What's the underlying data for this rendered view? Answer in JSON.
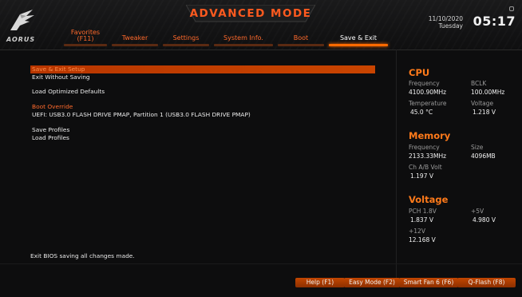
{
  "brand": {
    "logo_text": "AORUS"
  },
  "header": {
    "title": "ADVANCED MODE",
    "date": "11/10/2020",
    "day": "Tuesday",
    "time": "05:17"
  },
  "tabs": [
    {
      "label_line1": "Favorites",
      "label_line2": "(F11)",
      "active": false
    },
    {
      "label": "Tweaker",
      "active": false
    },
    {
      "label": "Settings",
      "active": false
    },
    {
      "label": "System Info.",
      "active": false
    },
    {
      "label": "Boot",
      "active": false
    },
    {
      "label": "Save & Exit",
      "active": true
    }
  ],
  "menu": {
    "save_exit_setup": "Save & Exit Setup",
    "exit_without_saving": "Exit Without Saving",
    "load_optimized_defaults": "Load Optimized Defaults",
    "boot_override_header": "Boot Override",
    "boot_override_device": "UEFI: USB3.0 FLASH DRIVE PMAP, Partition 1 (USB3.0 FLASH DRIVE PMAP)",
    "save_profiles": "Save Profiles",
    "load_profiles": "Load Profiles"
  },
  "status_text": "Exit BIOS saving all changes made.",
  "sidebar": {
    "cpu": {
      "title": "CPU",
      "frequency_label": "Frequency",
      "frequency_value": "4100.90MHz",
      "bclk_label": "BCLK",
      "bclk_value": "100.00MHz",
      "temperature_label": "Temperature",
      "temperature_value": "45.0 °C",
      "voltage_label": "Voltage",
      "voltage_value": "1.218 V"
    },
    "memory": {
      "title": "Memory",
      "frequency_label": "Frequency",
      "frequency_value": "2133.33MHz",
      "size_label": "Size",
      "size_value": "4096MB",
      "chab_label": "Ch A/B Volt",
      "chab_value": "1.197 V"
    },
    "voltage": {
      "title": "Voltage",
      "pch_label": "PCH 1.8V",
      "pch_value": "1.837 V",
      "p5v_label": "+5V",
      "p5v_value": "4.980 V",
      "p12v_label": "+12V",
      "p12v_value": "12.168 V"
    }
  },
  "footer_buttons": {
    "help": "Help (F1)",
    "easy_mode": "Easy Mode (F2)",
    "smart_fan": "Smart Fan 6 (F6)",
    "qflash": "Q-Flash (F8)"
  },
  "colors": {
    "accent": "#ff6a00",
    "selected_row": "#c24400",
    "background": "#0d0d0e"
  }
}
